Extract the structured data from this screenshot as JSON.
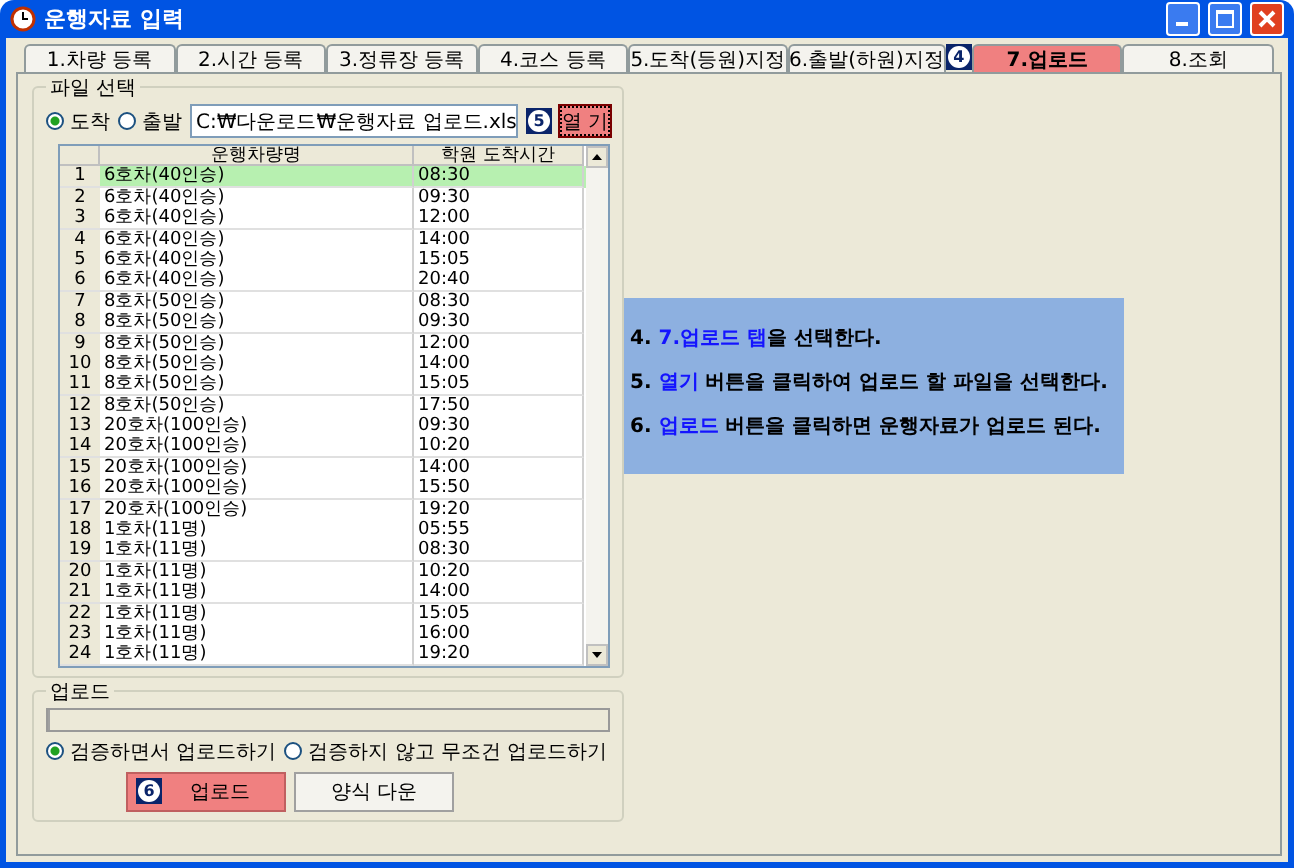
{
  "window": {
    "title": "운행자료 입력"
  },
  "tabs": [
    {
      "label": "1.차량 등록",
      "selected": false
    },
    {
      "label": "2.시간 등록",
      "selected": false
    },
    {
      "label": "3.정류장 등록",
      "selected": false
    },
    {
      "label": "4.코스 등록",
      "selected": false
    },
    {
      "label": "5.도착(등원)지정",
      "selected": false
    },
    {
      "label": "6.출발(하원)지정",
      "selected": false
    },
    {
      "label": "7.업로드",
      "selected": true,
      "badge": "4"
    },
    {
      "label": "8.조회",
      "selected": false
    }
  ],
  "file_group": {
    "title": "파일 선택",
    "radios": [
      {
        "label": "도착",
        "selected": true
      },
      {
        "label": "출발",
        "selected": false
      }
    ],
    "path": "C:₩다운로드₩운행자료 업로드.xls",
    "open_badge": "5",
    "open_button": "열 기"
  },
  "grid": {
    "columns": [
      "운행차량명",
      "학원 도착시간"
    ],
    "rows": [
      {
        "num": "1",
        "name": "6호차(40인승)",
        "time": "08:30",
        "selected": true
      },
      {
        "num": "2",
        "name": "6호차(40인승)",
        "time": "09:30",
        "selected": false
      },
      {
        "num": "3",
        "name": "6호차(40인승)",
        "time": "12:00",
        "selected": false
      },
      {
        "num": "4",
        "name": "6호차(40인승)",
        "time": "14:00",
        "selected": false
      },
      {
        "num": "5",
        "name": "6호차(40인승)",
        "time": "15:05",
        "selected": false
      },
      {
        "num": "6",
        "name": "6호차(40인승)",
        "time": "20:40",
        "selected": false
      },
      {
        "num": "7",
        "name": "8호차(50인승)",
        "time": "08:30",
        "selected": false
      },
      {
        "num": "8",
        "name": "8호차(50인승)",
        "time": "09:30",
        "selected": false
      },
      {
        "num": "9",
        "name": "8호차(50인승)",
        "time": "12:00",
        "selected": false
      },
      {
        "num": "10",
        "name": "8호차(50인승)",
        "time": "14:00",
        "selected": false
      },
      {
        "num": "11",
        "name": "8호차(50인승)",
        "time": "15:05",
        "selected": false
      },
      {
        "num": "12",
        "name": "8호차(50인승)",
        "time": "17:50",
        "selected": false
      },
      {
        "num": "13",
        "name": "20호차(100인승)",
        "time": "09:30",
        "selected": false
      },
      {
        "num": "14",
        "name": "20호차(100인승)",
        "time": "10:20",
        "selected": false
      },
      {
        "num": "15",
        "name": "20호차(100인승)",
        "time": "14:00",
        "selected": false
      },
      {
        "num": "16",
        "name": "20호차(100인승)",
        "time": "15:50",
        "selected": false
      },
      {
        "num": "17",
        "name": "20호차(100인승)",
        "time": "19:20",
        "selected": false
      },
      {
        "num": "18",
        "name": "1호차(11명)",
        "time": "05:55",
        "selected": false
      },
      {
        "num": "19",
        "name": "1호차(11명)",
        "time": "08:30",
        "selected": false
      },
      {
        "num": "20",
        "name": "1호차(11명)",
        "time": "10:20",
        "selected": false
      },
      {
        "num": "21",
        "name": "1호차(11명)",
        "time": "14:00",
        "selected": false
      },
      {
        "num": "22",
        "name": "1호차(11명)",
        "time": "15:05",
        "selected": false
      },
      {
        "num": "23",
        "name": "1호차(11명)",
        "time": "16:00",
        "selected": false
      },
      {
        "num": "24",
        "name": "1호차(11명)",
        "time": "19:20",
        "selected": false
      }
    ]
  },
  "callout": [
    {
      "prefix": "4. ",
      "highlight": "7.업로드 탭",
      "rest": "을 선택한다."
    },
    {
      "prefix": "5. ",
      "highlight": "열기",
      "rest": " 버튼을 클릭하여 업로드 할 파일을 선택한다."
    },
    {
      "prefix": "6. ",
      "highlight": "업로드",
      "rest": " 버튼을 클릭하면 운행자료가 업로드 된다."
    }
  ],
  "upload_group": {
    "title": "업로드",
    "progress": {
      "level": 0
    },
    "radios": [
      {
        "label": "검증하면서 업로드하기",
        "selected": true
      },
      {
        "label": "검증하지 않고 무조건 업로드하기",
        "selected": false
      }
    ],
    "upload_badge": "6",
    "upload_button": "업로드",
    "template_button": "양식 다운"
  }
}
